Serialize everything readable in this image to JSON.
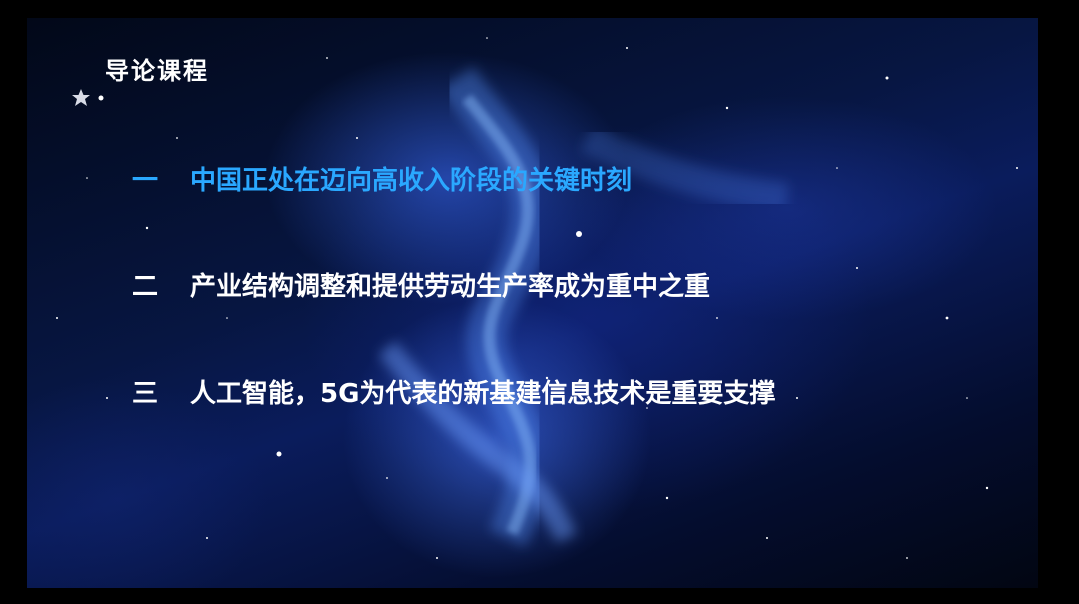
{
  "slide": {
    "title": "导论课程",
    "items": [
      {
        "number": "一",
        "text": "中国正处在迈向高收入阶段的关键时刻",
        "active": true
      },
      {
        "number": "二",
        "text": "产业结构调整和提供劳动生产率成为重中之重",
        "active": false
      },
      {
        "number": "三",
        "text": "人工智能，5G为代表的新基建信息技术是重要支撑",
        "active": false
      }
    ]
  },
  "colors": {
    "background": "#071642",
    "accent": "#2aa8ff",
    "text": "#ffffff"
  },
  "icons": {
    "title_ornament": "star-icon"
  }
}
